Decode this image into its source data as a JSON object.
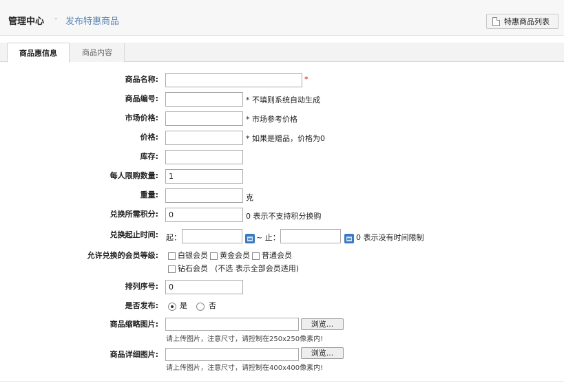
{
  "header": {
    "title": "管理中心",
    "separator": "-",
    "subtitle": "发布特惠商品",
    "list_button_label": "特惠商品列表"
  },
  "tabs": [
    {
      "label": "商品惠信息",
      "active": true
    },
    {
      "label": "商品内容",
      "active": false
    }
  ],
  "form": {
    "name": {
      "label": "商品名称:",
      "value": "",
      "required_mark": "*"
    },
    "code": {
      "label": "商品编号:",
      "value": "",
      "hint": "* 不填则系统自动生成"
    },
    "market_price": {
      "label": "市场价格:",
      "value": "",
      "hint": "* 市场参考价格"
    },
    "price": {
      "label": "价格:",
      "value": "",
      "hint": "* 如果是赠品，价格为0"
    },
    "stock": {
      "label": "库存:",
      "value": ""
    },
    "limit": {
      "label": "每人限购数量:",
      "value": "1"
    },
    "weight": {
      "label": "重量:",
      "value": "",
      "unit": "克"
    },
    "points": {
      "label": "兑换所需积分:",
      "value": "0",
      "hint": "0 表示不支持积分换购"
    },
    "period": {
      "label": "兑换起止时间:",
      "start_label": "起：",
      "start_value": "",
      "mid_label": "~ 止：",
      "end_value": "",
      "hint": "0 表示没有时间限制"
    },
    "member_levels": {
      "label": "允许兑换的会员等级:",
      "options": [
        {
          "label": "白银会员",
          "checked": false
        },
        {
          "label": "黄金会员",
          "checked": false
        },
        {
          "label": "普通会员",
          "checked": false
        },
        {
          "label": "钻石会员",
          "checked": false
        }
      ],
      "note": "(不选 表示全部会员适用)"
    },
    "sort": {
      "label": "排列序号:",
      "value": "0"
    },
    "publish": {
      "label": "是否发布:",
      "options": [
        "是",
        "否"
      ],
      "selected": "是"
    },
    "thumb_image": {
      "label": "商品缩略图片:",
      "value": "",
      "browse_label": "浏览...",
      "note": "请上传图片，注意尺寸，请控制在250x250像素内!"
    },
    "detail_image": {
      "label": "商品详细图片:",
      "value": "",
      "browse_label": "浏览...",
      "note": "请上传图片，注意尺寸，请控制在400x400像素内!"
    }
  },
  "colors": {
    "accent": "#5b86b3",
    "required": "#dd0000",
    "calendar_icon": "#3b79c1"
  }
}
